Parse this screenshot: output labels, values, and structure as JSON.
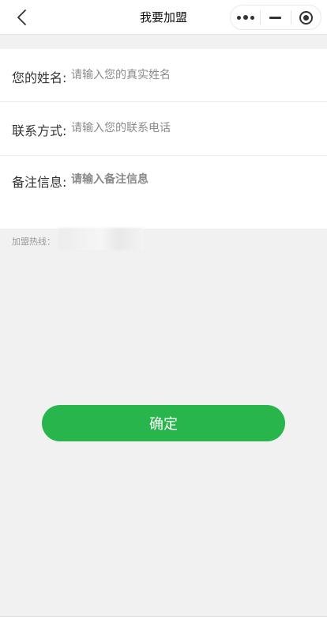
{
  "navbar": {
    "title": "我要加盟",
    "back_icon": "chevron-left-icon",
    "capsule": {
      "more_icon": "more-dots-icon",
      "minimize_icon": "minus-icon",
      "close_icon": "target-circle-icon"
    }
  },
  "form": {
    "name": {
      "label": "您的姓名:",
      "placeholder": "请输入您的真实姓名",
      "value": ""
    },
    "contact": {
      "label": "联系方式:",
      "placeholder": "请输入您的联系电话",
      "value": ""
    },
    "note": {
      "label": "备注信息:",
      "placeholder": "请输入备注信息",
      "value": ""
    }
  },
  "hotline": {
    "label": "加盟热线："
  },
  "confirm_button": {
    "label": "确定",
    "color": "#27b54c"
  }
}
